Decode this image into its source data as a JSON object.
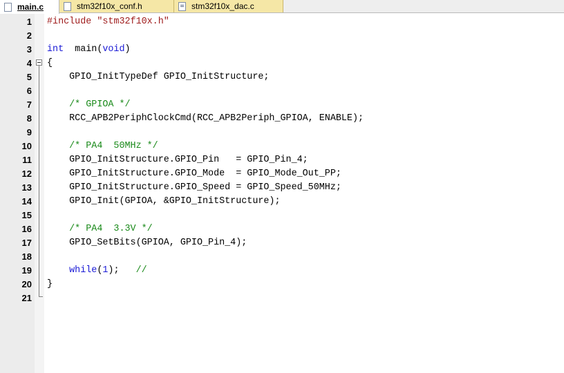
{
  "tabs": [
    {
      "label": "main.c",
      "active": true,
      "icon": "c-file-icon"
    },
    {
      "label": "stm32f10x_conf.h",
      "active": false,
      "icon": "h-file-icon"
    },
    {
      "label": "stm32f10x_dac.c",
      "active": false,
      "icon": "h-file-icon"
    }
  ],
  "colors": {
    "keyword": "#1a1ad6",
    "comment": "#1a8a1a",
    "string": "#a01e1e",
    "tab_inactive": "#f5e7a6"
  },
  "lines": [
    {
      "n": "1",
      "t": [
        [
          "pp",
          "#include "
        ],
        [
          "str",
          "\"stm32f10x.h\""
        ]
      ]
    },
    {
      "n": "2",
      "t": []
    },
    {
      "n": "3",
      "t": [
        [
          "kw",
          "int"
        ],
        [
          "",
          "  main("
        ],
        [
          "kw",
          "void"
        ],
        [
          "",
          ")"
        ]
      ]
    },
    {
      "n": "4",
      "t": [
        [
          "",
          "{"
        ]
      ]
    },
    {
      "n": "5",
      "t": [
        [
          "",
          "    GPIO_InitTypeDef GPIO_InitStructure;"
        ]
      ]
    },
    {
      "n": "6",
      "t": []
    },
    {
      "n": "7",
      "t": [
        [
          "cm",
          "    /* GPIOA */"
        ]
      ]
    },
    {
      "n": "8",
      "t": [
        [
          "",
          "    RCC_APB2PeriphClockCmd(RCC_APB2Periph_GPIOA, ENABLE);"
        ]
      ]
    },
    {
      "n": "9",
      "t": []
    },
    {
      "n": "10",
      "t": [
        [
          "cm",
          "    /* PA4  50MHz */"
        ]
      ]
    },
    {
      "n": "11",
      "t": [
        [
          "",
          "    GPIO_InitStructure.GPIO_Pin   = GPIO_Pin_4;"
        ]
      ]
    },
    {
      "n": "12",
      "t": [
        [
          "",
          "    GPIO_InitStructure.GPIO_Mode  = GPIO_Mode_Out_PP;"
        ]
      ]
    },
    {
      "n": "13",
      "t": [
        [
          "",
          "    GPIO_InitStructure.GPIO_Speed = GPIO_Speed_50MHz;"
        ]
      ]
    },
    {
      "n": "14",
      "t": [
        [
          "",
          "    GPIO_Init(GPIOA, &GPIO_InitStructure);"
        ]
      ]
    },
    {
      "n": "15",
      "t": []
    },
    {
      "n": "16",
      "t": [
        [
          "cm",
          "    /* PA4  3.3V */"
        ]
      ]
    },
    {
      "n": "17",
      "t": [
        [
          "",
          "    GPIO_SetBits(GPIOA, GPIO_Pin_4);"
        ]
      ]
    },
    {
      "n": "18",
      "t": []
    },
    {
      "n": "19",
      "t": [
        [
          "kw",
          "    while"
        ],
        [
          "",
          "("
        ],
        [
          "kw",
          "1"
        ],
        [
          "",
          ");   "
        ],
        [
          "cm",
          "//"
        ]
      ]
    },
    {
      "n": "20",
      "t": [
        [
          "",
          "}"
        ]
      ]
    },
    {
      "n": "21",
      "t": []
    }
  ]
}
